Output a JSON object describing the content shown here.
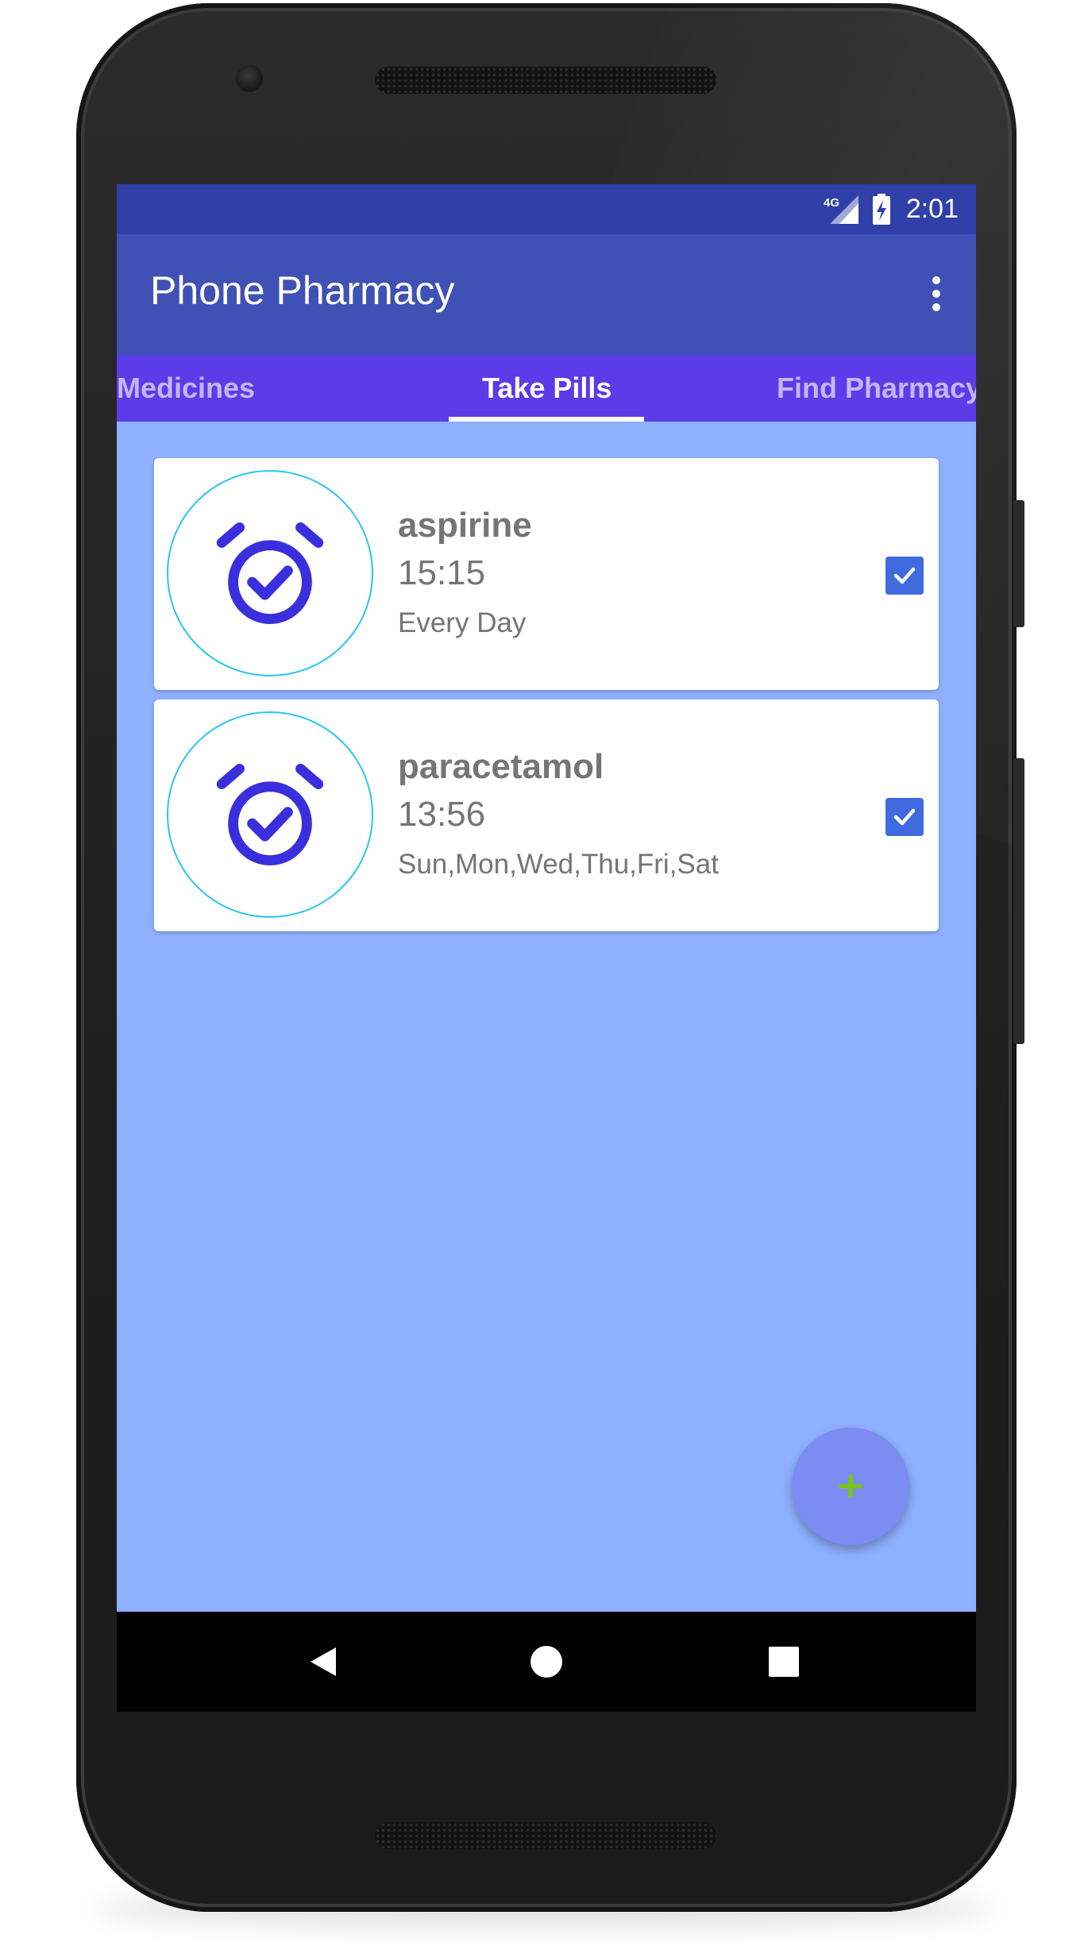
{
  "status_bar": {
    "network_label": "4G",
    "time": "2:01",
    "icons": [
      "signal-icon",
      "battery-charging-icon"
    ]
  },
  "app_bar": {
    "title": "Phone Pharmacy",
    "overflow_icon": "more-vert-icon"
  },
  "tabs": [
    {
      "label": "Medicines",
      "selected": false
    },
    {
      "label": "Take Pills",
      "selected": true
    },
    {
      "label": "Find Pharmacy",
      "selected": false
    }
  ],
  "reminders": [
    {
      "name": "aspirine",
      "time": "15:15",
      "days": "Every Day",
      "checked": true,
      "icon": "alarm-check-icon"
    },
    {
      "name": "paracetamol",
      "time": "13:56",
      "days": "Sun,Mon,Wed,Thu,Fri,Sat",
      "checked": true,
      "icon": "alarm-check-icon"
    }
  ],
  "fab": {
    "label": "+",
    "icon": "add-icon"
  },
  "nav_bar": {
    "buttons": [
      "back-icon",
      "home-icon",
      "recents-icon"
    ]
  },
  "colors": {
    "status_bar": "#3040a8",
    "app_bar": "#3f51b5",
    "tab_bar": "#5a3ce8",
    "background": "#8fb0ff",
    "card": "#ffffff",
    "checkbox": "#3f6ae0",
    "alarm_icon": "#3a2fdc",
    "fab": "#7b8cf2",
    "fab_plus": "#76c21f"
  }
}
